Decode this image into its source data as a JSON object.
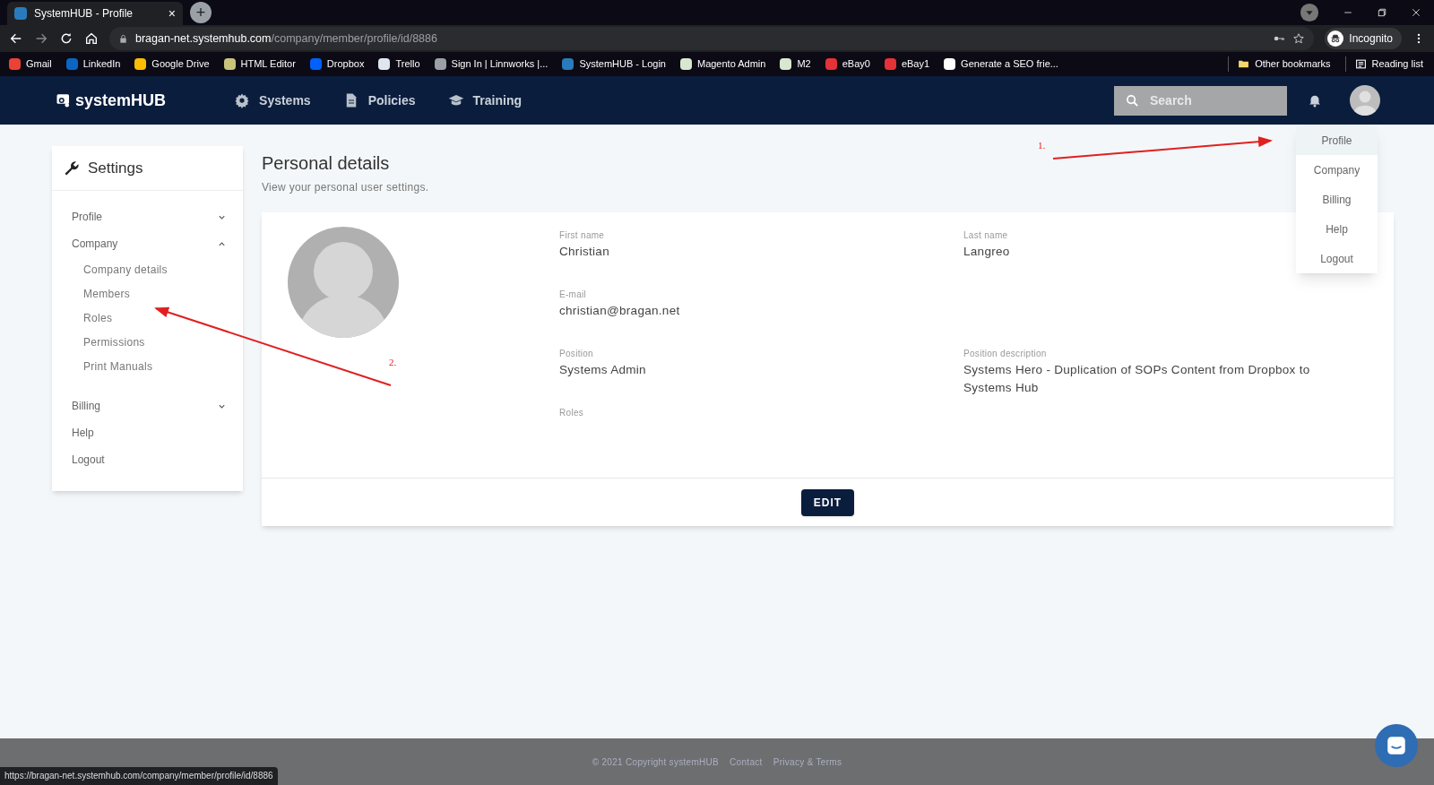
{
  "browser": {
    "tab_title": "SystemHUB - Profile",
    "tab_close": "×",
    "new_tab": "+",
    "url_host": "bragan-net.systemhub.com",
    "url_path": "/company/member/profile/id/8886",
    "profile": "Incognito",
    "bookmarks": [
      {
        "label": "Gmail",
        "color": "#ea4335"
      },
      {
        "label": "LinkedIn",
        "color": "#0a66c2"
      },
      {
        "label": "Google Drive",
        "color": "#fbbc04"
      },
      {
        "label": "HTML Editor",
        "color": "#c9c47a"
      },
      {
        "label": "Dropbox",
        "color": "#0061fe"
      },
      {
        "label": "Trello",
        "color": "#dfe6f0"
      },
      {
        "label": "Sign In | Linnworks |...",
        "color": "#9aa0a6"
      },
      {
        "label": "SystemHUB - Login",
        "color": "#2a7bbd"
      },
      {
        "label": "Magento Admin",
        "color": "#d8e8d0"
      },
      {
        "label": "M2",
        "color": "#d8e8d0"
      },
      {
        "label": "eBay0",
        "color": "#e53238"
      },
      {
        "label": "eBay1",
        "color": "#e53238"
      },
      {
        "label": "Generate a SEO frie...",
        "color": "#ffffff"
      }
    ],
    "other_bookmarks": "Other bookmarks",
    "reading_list": "Reading list",
    "status_url": "https://bragan-net.systemhub.com/company/member/profile/id/8886"
  },
  "app": {
    "logo": "systemHUB",
    "nav": [
      {
        "label": "Systems",
        "kind": "gear"
      },
      {
        "label": "Policies",
        "kind": "document"
      },
      {
        "label": "Training",
        "kind": "cap"
      }
    ],
    "search": {
      "placeholder": "Search"
    },
    "user_menu": [
      {
        "label": "Profile",
        "selected": true
      },
      {
        "label": "Company",
        "selected": false
      },
      {
        "label": "Billing",
        "selected": false
      },
      {
        "label": "Help",
        "selected": false
      },
      {
        "label": "Logout",
        "selected": false
      }
    ]
  },
  "sidebar": {
    "title": "Settings",
    "items": [
      {
        "label": "Profile",
        "expanded": false
      },
      {
        "label": "Company",
        "expanded": true,
        "children": [
          {
            "label": "Company details"
          },
          {
            "label": "Members"
          },
          {
            "label": "Roles"
          },
          {
            "label": "Permissions"
          },
          {
            "label": "Print Manuals"
          }
        ]
      },
      {
        "label": "Billing",
        "expanded": false
      },
      {
        "label": "Help"
      },
      {
        "label": "Logout"
      }
    ]
  },
  "page": {
    "title": "Personal details",
    "subtitle": "View your personal user settings.",
    "fields": [
      {
        "label": "First name",
        "value": "Christian"
      },
      {
        "label": "Last name",
        "value": "Langreo"
      },
      {
        "label": "E-mail",
        "value": "christian@bragan.net"
      },
      {
        "label": "Position",
        "value": "Systems Admin"
      },
      {
        "label": "Position description",
        "value": "Systems Hero - Duplication of SOPs Content from Dropbox to Systems Hub"
      },
      {
        "label": "Roles"
      }
    ],
    "edit_button": "EDIT"
  },
  "annotations": [
    {
      "label": "1."
    },
    {
      "label": "2."
    }
  ],
  "footer": {
    "copyright": "© 2021 Copyright systemHUB",
    "links": [
      "Contact",
      "Privacy & Terms"
    ]
  }
}
